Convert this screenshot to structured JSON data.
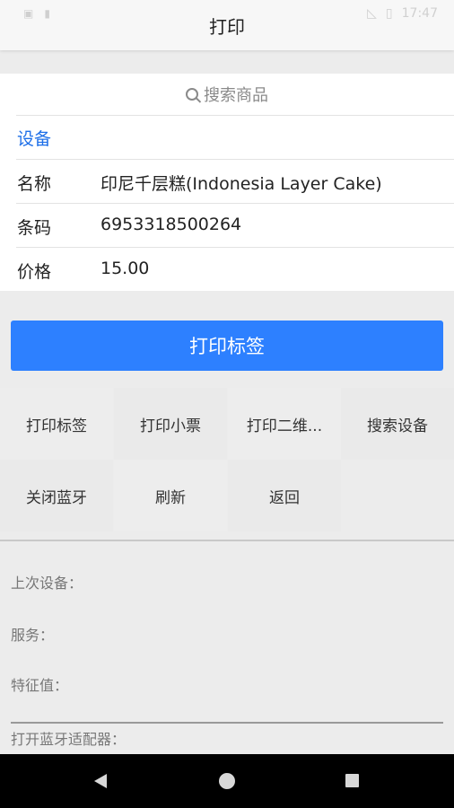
{
  "status": {
    "time": "17:47"
  },
  "app": {
    "title": "打印"
  },
  "search": {
    "placeholder": "搜索商品"
  },
  "device": {
    "label": "设备"
  },
  "fields": [
    {
      "label": "名称",
      "value": "印尼千层糕(Indonesia Layer Cake)"
    },
    {
      "label": "条码",
      "value": "6953318500264"
    },
    {
      "label": "价格",
      "value": "15.00"
    }
  ],
  "primary_button": {
    "label": "打印标签"
  },
  "actions": [
    {
      "label": "打印标签"
    },
    {
      "label": "打印小票"
    },
    {
      "label": "打印二维..."
    },
    {
      "label": "搜索设备"
    },
    {
      "label": "关闭蓝牙"
    },
    {
      "label": "刷新"
    },
    {
      "label": "返回"
    }
  ],
  "info": {
    "last_device": "上次设备：",
    "service": "服务：",
    "characteristic": "特征值：",
    "log_open_adapter": "打开蓝牙适配器："
  }
}
